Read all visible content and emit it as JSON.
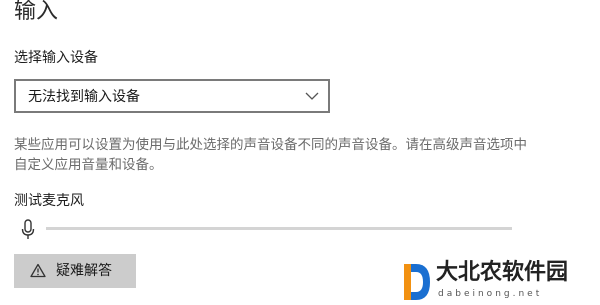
{
  "section": {
    "title": "输入"
  },
  "input_device": {
    "label": "选择输入设备",
    "selected_value": "无法找到输入设备"
  },
  "description": "某些应用可以设置为使用与此处选择的声音设备不同的声音设备。请在高级声音选项中自定义应用音量和设备。",
  "mic_test": {
    "label": "测试麦克风",
    "level": 0
  },
  "troubleshoot": {
    "label": "疑难解答"
  },
  "watermark": {
    "title": "大北农软件园",
    "url": "dabeinong.net"
  },
  "icons": {
    "dropdown": "chevron-down-icon",
    "microphone": "microphone-icon",
    "troubleshoot": "warning-icon",
    "watermark_logo": "logo-icon"
  },
  "colors": {
    "accent": "#0078d7",
    "button_bg": "#cccccc",
    "border": "#7a7a7a",
    "secondary_text": "#6b6b6b",
    "logo_blue": "#1a6fd1",
    "logo_orange": "#f29111"
  }
}
